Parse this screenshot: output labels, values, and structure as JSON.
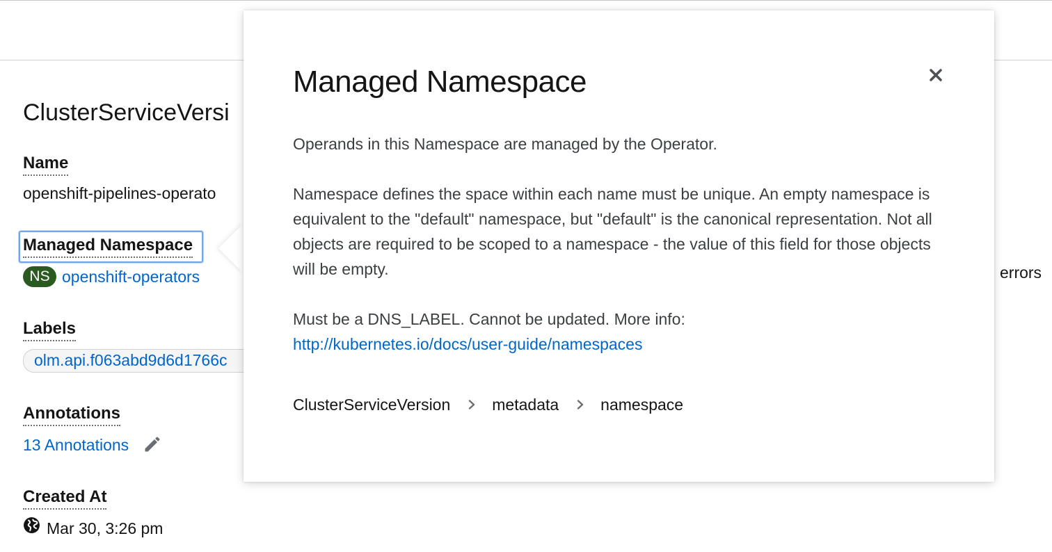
{
  "details": {
    "section_title": "ClusterServiceVersi",
    "name_label": "Name",
    "name_value": "openshift-pipelines-operato",
    "managed_namespace_label": "Managed Namespace",
    "namespace_badge": "NS",
    "namespace_value": "openshift-operators",
    "labels_label": "Labels",
    "label_chip": "olm.api.f063abd9d6d1766c",
    "annotations_label": "Annotations",
    "annotations_link": "13 Annotations",
    "created_at_label": "Created At",
    "created_at_value": "Mar 30, 3:26 pm"
  },
  "right_column": {
    "errors_text": "errors"
  },
  "popover": {
    "title": "Managed Namespace",
    "paragraph1": "Operands in this Namespace are managed by the Operator.",
    "paragraph2": "Namespace defines the space within each name must be unique. An empty namespace is equivalent to the \"default\" namespace, but \"default\" is the canonical representation. Not all objects are required to be scoped to a namespace - the value of this field for those objects will be empty.",
    "paragraph3": "Must be a DNS_LABEL. Cannot be updated. More info:",
    "more_info_link": "http://kubernetes.io/docs/user-guide/namespaces",
    "breadcrumb": [
      "ClusterServiceVersion",
      "metadata",
      "namespace"
    ]
  },
  "colors": {
    "link": "#0066cc",
    "namespace_badge": "#2b5a20",
    "focus_ring": "#73a5e6"
  },
  "icons": {
    "close": "close-icon",
    "edit": "pencil-icon",
    "timestamp": "globe-icon",
    "breadcrumb_separator": "chevron-right-icon"
  }
}
